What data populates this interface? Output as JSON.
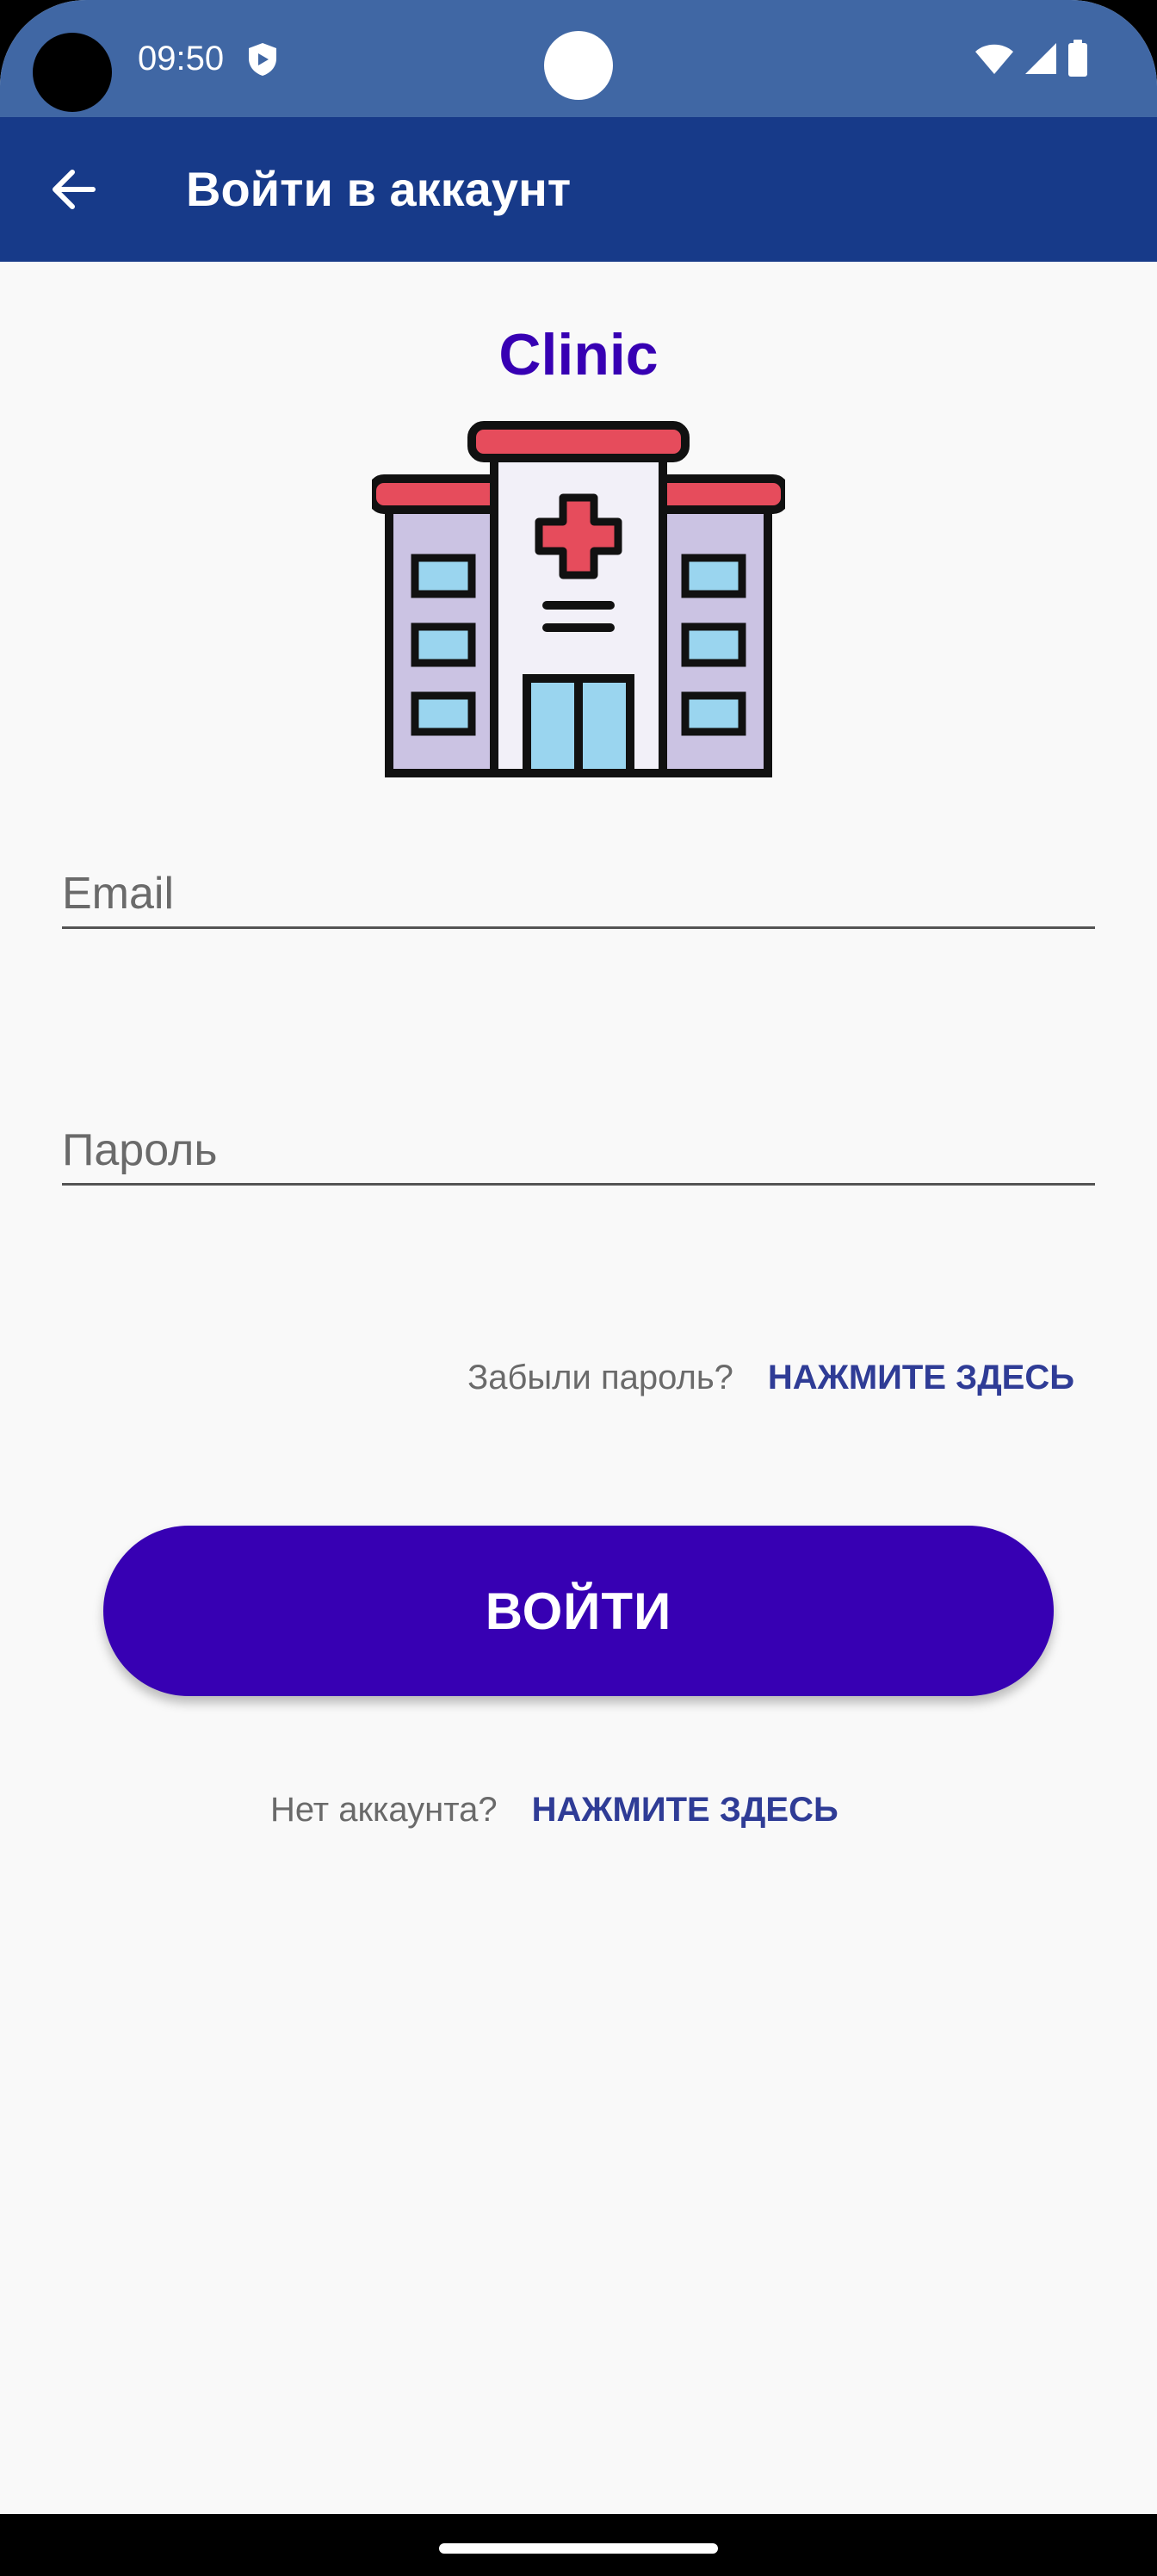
{
  "status_bar": {
    "time": "09:50",
    "icons": [
      "shield-icon",
      "wifi-icon",
      "cell-signal-icon",
      "battery-icon"
    ],
    "background": "#4067a4"
  },
  "app_bar": {
    "title": "Войти в аккаунт",
    "back_icon": "arrow-left-icon",
    "background": "#173a89"
  },
  "brand": {
    "name": "Clinic",
    "logo_icon": "hospital-building-icon",
    "color": "#3700b3"
  },
  "form": {
    "email": {
      "placeholder": "Email",
      "value": ""
    },
    "password": {
      "placeholder": "Пароль",
      "value": ""
    },
    "forgot_prompt": "Забыли пароль?",
    "forgot_link": "НАЖМИТЕ ЗДЕСЬ",
    "login_button": "ВОЙТИ",
    "register_prompt": "Нет аккаунта?",
    "register_link": "НАЖМИТЕ ЗДЕСЬ"
  },
  "colors": {
    "accent": "#3700b3",
    "link": "#2f3c96",
    "background": "#f9f9f9"
  }
}
